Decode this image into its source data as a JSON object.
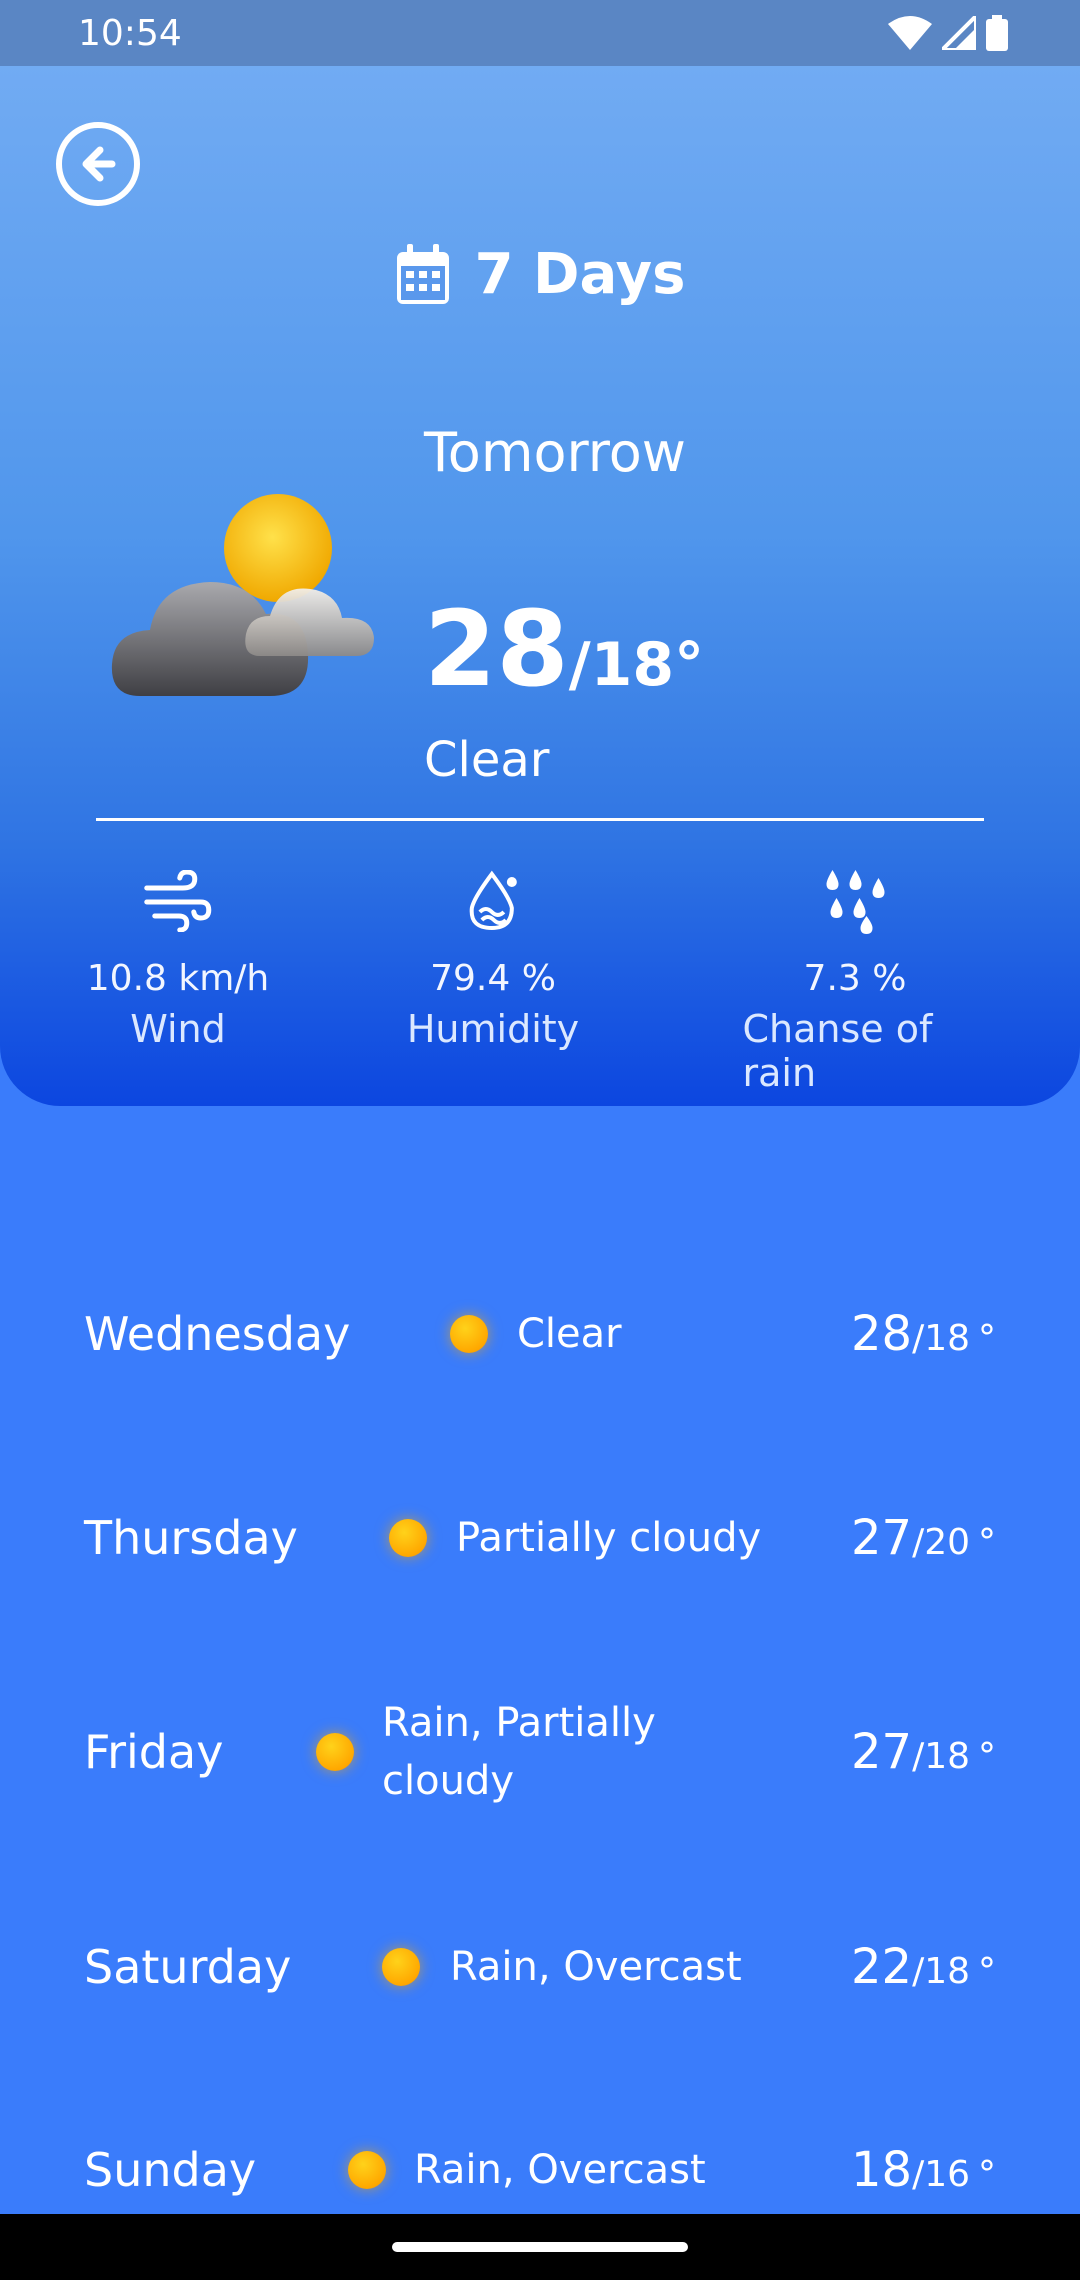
{
  "status_bar": {
    "time": "10:54"
  },
  "header": {
    "title": "7 Days"
  },
  "today": {
    "label": "Tomorrow",
    "temp_high": "28",
    "temp_low": "/18°",
    "condition": "Clear",
    "icon": "sun-behind-cloud-icon"
  },
  "stats": [
    {
      "icon": "wind-icon",
      "value": "10.8 km/h",
      "label": "Wind"
    },
    {
      "icon": "humidity-icon",
      "value": "79.4 %",
      "label": "Humidity"
    },
    {
      "icon": "rain-drops-icon",
      "value": "7.3 %",
      "label": "Chanse of rain"
    }
  ],
  "forecast": [
    {
      "day": "Wednesday",
      "condition": "Clear",
      "high": "28",
      "low": "/18",
      "unit": "°"
    },
    {
      "day": "Thursday",
      "condition": "Partially cloudy",
      "high": "27",
      "low": "/20",
      "unit": "°"
    },
    {
      "day": "Friday",
      "condition": "Rain, Partially cloudy",
      "high": "27",
      "low": "/18",
      "unit": "°"
    },
    {
      "day": "Saturday",
      "condition": "Rain, Overcast",
      "high": "22",
      "low": "/18",
      "unit": "°"
    },
    {
      "day": "Sunday",
      "condition": "Rain, Overcast",
      "high": "18",
      "low": "/16",
      "unit": "°"
    }
  ],
  "colors": {
    "background": "#3a7cfb",
    "hero_top": "#71abf3",
    "hero_bottom": "#0c46e0",
    "sun": "#ffb300"
  }
}
